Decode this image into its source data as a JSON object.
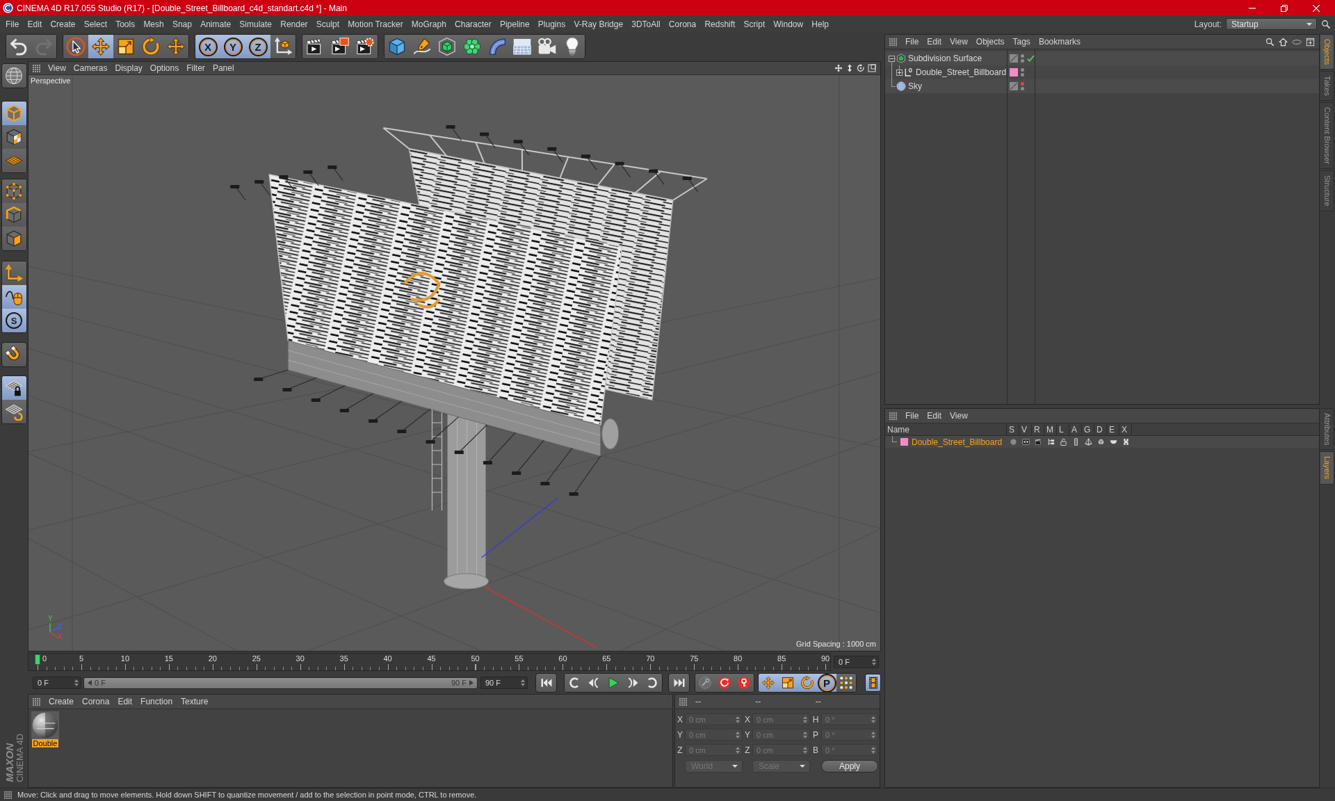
{
  "window": {
    "title": "CINEMA 4D R17.055 Studio (R17) - [Double_Street_Billboard_c4d_standart.c4d *] - Main"
  },
  "menu_bar": {
    "items": [
      "File",
      "Edit",
      "Create",
      "Select",
      "Tools",
      "Mesh",
      "Snap",
      "Animate",
      "Simulate",
      "Render",
      "Sculpt",
      "Motion Tracker",
      "MoGraph",
      "Character",
      "Pipeline",
      "Plugins",
      "V-Ray Bridge",
      "3DToAll",
      "Corona",
      "Redshift",
      "Script",
      "Window",
      "Help"
    ],
    "layout_label": "Layout:",
    "layout_value": "Startup"
  },
  "toolbar": {
    "groups": [
      [
        {
          "kind": "undo",
          "disabled": false
        },
        {
          "kind": "redo",
          "disabled": true
        }
      ],
      [
        {
          "kind": "live-selection",
          "selected": false
        },
        {
          "kind": "move",
          "selected": true
        },
        {
          "kind": "scale",
          "selected": false
        },
        {
          "kind": "rotate",
          "selected": false
        },
        {
          "kind": "recent-tool",
          "selected": false
        }
      ],
      [
        {
          "kind": "axis-lock",
          "label": "X",
          "selected": true
        },
        {
          "kind": "axis-lock",
          "label": "Y",
          "selected": true
        },
        {
          "kind": "axis-lock",
          "label": "Z",
          "selected": true
        },
        {
          "kind": "coordinate-system",
          "selected": false
        }
      ],
      [
        {
          "kind": "render-view"
        },
        {
          "kind": "render-picture-viewer"
        },
        {
          "kind": "render-settings"
        }
      ],
      [
        {
          "kind": "cube"
        },
        {
          "kind": "pen"
        },
        {
          "kind": "subdivision"
        },
        {
          "kind": "cloner"
        },
        {
          "kind": "bend"
        },
        {
          "kind": "floor"
        },
        {
          "kind": "camera"
        },
        {
          "kind": "light"
        }
      ]
    ]
  },
  "mode_bar": {
    "groups": [
      [
        {
          "kind": "make-editable",
          "selected": false
        }
      ],
      [
        {
          "kind": "model",
          "selected": true
        },
        {
          "kind": "texture",
          "selected": false
        },
        {
          "kind": "workplane",
          "selected": false
        }
      ],
      [
        {
          "kind": "points",
          "selected": false
        },
        {
          "kind": "edges",
          "selected": false
        },
        {
          "kind": "polygons",
          "selected": false
        }
      ],
      [
        {
          "kind": "axis",
          "selected": false
        },
        {
          "kind": "tweak",
          "selected": true
        },
        {
          "kind": "solo",
          "label": "S",
          "selected": true
        }
      ],
      [
        {
          "kind": "snap",
          "selected": false
        }
      ],
      [
        {
          "kind": "lock-workplane",
          "selected": true
        },
        {
          "kind": "planar-workplane",
          "selected": false
        }
      ]
    ]
  },
  "viewport": {
    "menu": [
      "View",
      "Cameras",
      "Display",
      "Options",
      "Filter",
      "Panel"
    ],
    "camera": "Perspective",
    "grid_spacing": "Grid Spacing : 1000 cm",
    "axes": [
      {
        "kind": "y",
        "label": "Y"
      },
      {
        "kind": "z",
        "label": "Z"
      },
      {
        "kind": "x",
        "label": "X"
      }
    ]
  },
  "object_manager": {
    "menu": [
      "File",
      "Edit",
      "View",
      "Objects",
      "Tags",
      "Bookmarks"
    ],
    "objects": [
      {
        "name": "Subdivision Surface",
        "kind": "subdivision",
        "expanded": true,
        "editor_hidden": false,
        "render_hidden": false,
        "enabled": true,
        "children": [
          {
            "name": "Double_Street_Billboard",
            "kind": "null",
            "expanded": false,
            "color": "#f28cc4",
            "editor_hidden": false,
            "render_hidden": false
          }
        ]
      },
      {
        "name": "Sky",
        "kind": "sky",
        "editor_hidden": true,
        "render_hidden": false
      }
    ]
  },
  "side_tabs": {
    "upper": [
      {
        "label": "Objects",
        "selected": true
      },
      {
        "label": "Takes",
        "selected": false
      },
      {
        "label": "Content Browser",
        "selected": false
      },
      {
        "label": "Structure",
        "selected": false
      }
    ],
    "lower": [
      {
        "label": "Attributes",
        "selected": false
      },
      {
        "label": "Layers",
        "selected": true
      }
    ]
  },
  "layer_manager": {
    "menu": [
      "File",
      "Edit",
      "View"
    ],
    "columns": [
      "Name",
      "S",
      "V",
      "R",
      "M",
      "L",
      "A",
      "G",
      "D",
      "E",
      "X"
    ],
    "layers": [
      {
        "name": "Double_Street_Billboard",
        "color": "#f28cc4",
        "selected": true,
        "flags": [
          {
            "kind": "solo",
            "on": false
          },
          {
            "kind": "view",
            "on": true
          },
          {
            "kind": "render",
            "on": true
          },
          {
            "kind": "manager",
            "on": true
          },
          {
            "kind": "lock",
            "on": false
          },
          {
            "kind": "animation",
            "on": true
          },
          {
            "kind": "generators",
            "on": true
          },
          {
            "kind": "deformers",
            "on": true
          },
          {
            "kind": "expressions",
            "on": true
          },
          {
            "kind": "xrefs",
            "on": true
          }
        ]
      }
    ]
  },
  "timeline": {
    "ticks": [
      "0",
      "5",
      "10",
      "15",
      "20",
      "25",
      "30",
      "35",
      "40",
      "45",
      "50",
      "55",
      "60",
      "65",
      "70",
      "75",
      "80",
      "85",
      "90"
    ],
    "level": 0,
    "current_frame": "0 F"
  },
  "playback": {
    "start_field": "0 F",
    "range": {
      "start": "0 F",
      "end": "90 F",
      "level": 1
    },
    "end_field": "90 F",
    "transport": [
      [
        {
          "kind": "go-start"
        }
      ],
      [
        {
          "kind": "previous-key"
        },
        {
          "kind": "previous-frame"
        },
        {
          "kind": "play"
        },
        {
          "kind": "next-frame"
        },
        {
          "kind": "next-key"
        }
      ],
      [
        {
          "kind": "go-end"
        }
      ]
    ],
    "record": [
      {
        "kind": "record-keys",
        "disabled": true
      },
      {
        "kind": "record-active",
        "disabled": false
      },
      {
        "kind": "autokey",
        "disabled": false
      }
    ],
    "key_toggles": [
      {
        "kind": "position",
        "selected": true
      },
      {
        "kind": "scale",
        "selected": true
      },
      {
        "kind": "rotation",
        "selected": true
      },
      {
        "kind": "parameter",
        "label": "P",
        "selected": true
      },
      {
        "kind": "point-level",
        "selected": false
      }
    ],
    "timeline_button": {
      "selected": true
    }
  },
  "material_manager": {
    "menu": [
      "Create",
      "Corona",
      "Edit",
      "Function",
      "Texture"
    ],
    "materials": [
      {
        "name": "Double",
        "selected": true
      }
    ]
  },
  "coordinates": {
    "headers": [
      "--",
      "--",
      "--"
    ],
    "rows": [
      [
        {
          "label": "X",
          "value": "0 cm"
        },
        {
          "label": "X",
          "value": "0 cm"
        },
        {
          "label": "H",
          "value": "0 °"
        }
      ],
      [
        {
          "label": "Y",
          "value": "0 cm"
        },
        {
          "label": "Y",
          "value": "0 cm"
        },
        {
          "label": "P",
          "value": "0 °"
        }
      ],
      [
        {
          "label": "Z",
          "value": "0 cm"
        },
        {
          "label": "Z",
          "value": "0 cm"
        },
        {
          "label": "B",
          "value": "0 °"
        }
      ]
    ],
    "dropdowns": [
      {
        "value": "World",
        "disabled": true
      },
      {
        "value": "Scale",
        "disabled": true
      }
    ],
    "apply": "Apply"
  },
  "branding": {
    "company": "MAXON",
    "product": "CINEMA 4D"
  },
  "status_bar": {
    "text": "Move: Click and drag to move elements. Hold down SHIFT to quantize movement / add to the selection in point mode, CTRL to remove."
  }
}
